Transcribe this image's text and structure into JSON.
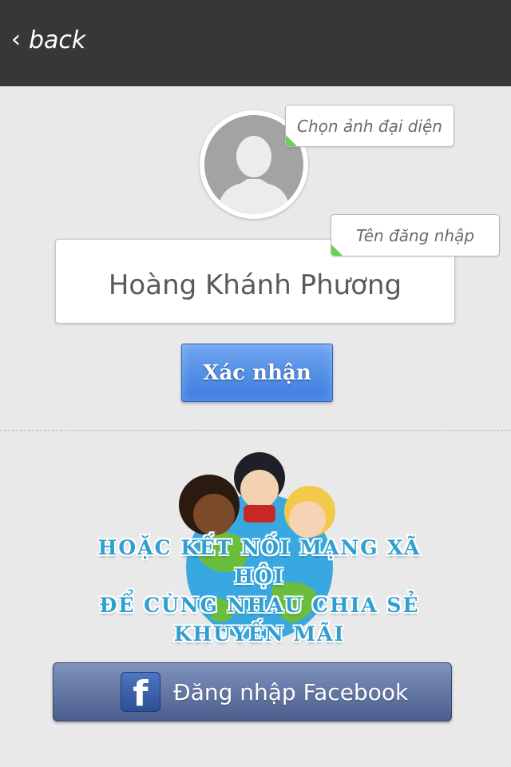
{
  "header": {
    "back_label": "back",
    "back_icon": "chevron-left-icon"
  },
  "avatar": {
    "tooltip": "Chọn ảnh đại diện",
    "icon": "person-silhouette-icon"
  },
  "username": {
    "tooltip": "Tên đăng nhập",
    "value": "Hoàng Khánh Phương"
  },
  "confirm": {
    "label": "Xác nhận"
  },
  "social": {
    "lines": [
      "Hoặc kết nối mạng xã hội",
      "để cùng nhau chia sẻ",
      "khuyến mãi"
    ]
  },
  "facebook": {
    "label": "Đăng nhập Facebook",
    "icon": "facebook-icon"
  },
  "colors": {
    "header_bg": "#383736",
    "page_bg": "#e9e9e9",
    "confirm_button": "#4a88e3",
    "facebook_button": "#5a6c9b",
    "tooltip_accent": "#6ccf5a",
    "social_text": "#2e9fd0"
  }
}
